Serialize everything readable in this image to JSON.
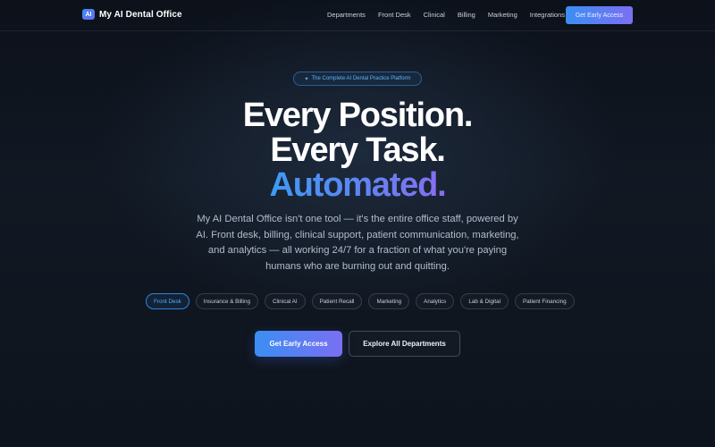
{
  "brand": {
    "badge": "AI",
    "name": "My AI Dental Office"
  },
  "nav": {
    "links": [
      "Departments",
      "Front Desk",
      "Clinical",
      "Billing",
      "Marketing",
      "Integrations"
    ],
    "cta": "Get Early Access"
  },
  "hero": {
    "pill_icon": "sparkle-icon",
    "pill": "The Complete AI Dental Practice Platform",
    "headline_1": "Every Position.",
    "headline_2": "Every Task.",
    "headline_3": "Automated.",
    "subtitle": "My AI Dental Office isn't one tool — it's the entire office staff, powered by AI. Front desk, billing, clinical support, patient communication, marketing, and analytics — all working 24/7 for a fraction of what you're paying humans who are burning out and quitting.",
    "tabs": [
      "Front Desk",
      "Insurance & Billing",
      "Clinical AI",
      "Patient Recall",
      "Marketing",
      "Analytics",
      "Lab & Digital",
      "Patient Financing"
    ],
    "active_tab": "Front Desk",
    "primary_cta": "Get Early Access",
    "secondary_cta": "Explore All Departments"
  },
  "colors": {
    "accent_blue": "#3b8ef3",
    "accent_purple": "#7a6ff2",
    "background": "#0e141d"
  }
}
